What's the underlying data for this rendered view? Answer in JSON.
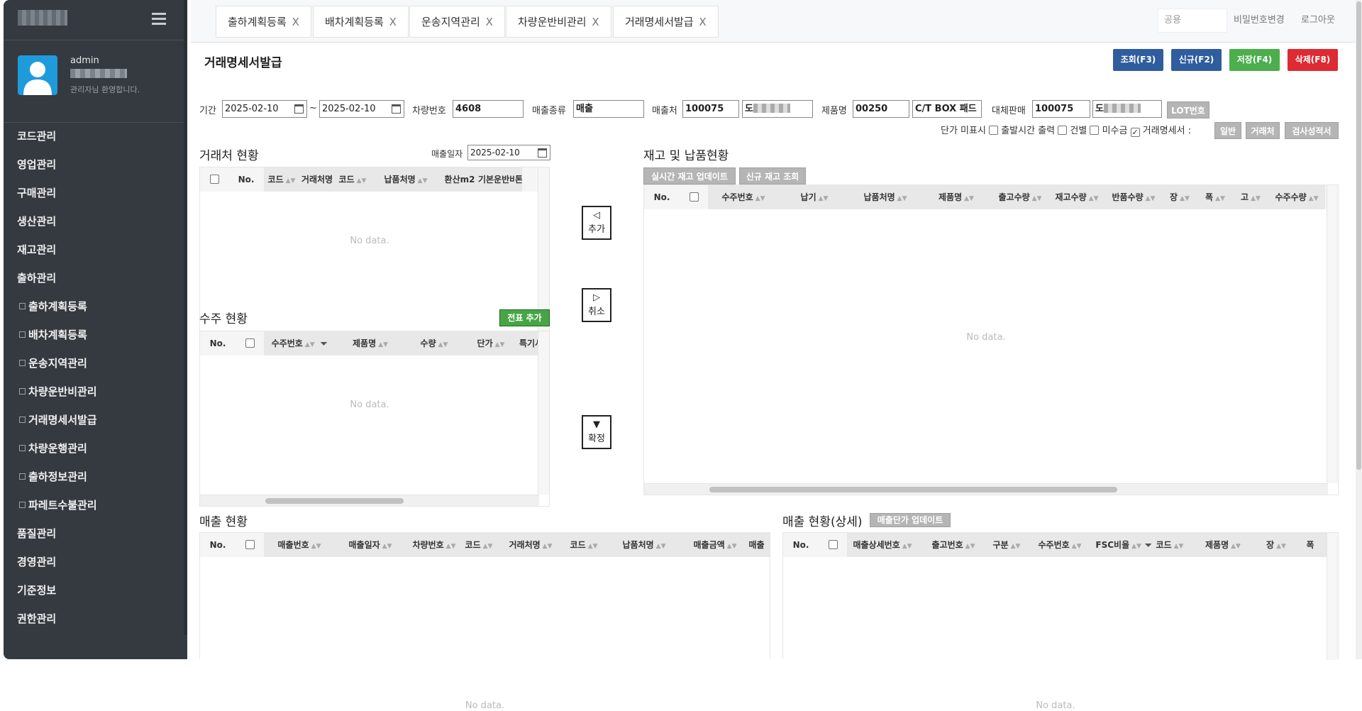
{
  "sidebar": {
    "user": {
      "name": "admin",
      "welcome": "관리자님 환영합니다."
    },
    "menu": [
      {
        "label": "코드관리",
        "sub": false
      },
      {
        "label": "영업관리",
        "sub": false
      },
      {
        "label": "구매관리",
        "sub": false
      },
      {
        "label": "생산관리",
        "sub": false
      },
      {
        "label": "재고관리",
        "sub": false
      },
      {
        "label": "출하관리",
        "sub": false
      },
      {
        "label": "출하계획등록",
        "sub": true
      },
      {
        "label": "배차계획등록",
        "sub": true
      },
      {
        "label": "운송지역관리",
        "sub": true
      },
      {
        "label": "차량운반비관리",
        "sub": true
      },
      {
        "label": "거래명세서발급",
        "sub": true
      },
      {
        "label": "차량운행관리",
        "sub": true
      },
      {
        "label": "출하정보관리",
        "sub": true
      },
      {
        "label": "파레트수불관리",
        "sub": true
      },
      {
        "label": "품질관리",
        "sub": false
      },
      {
        "label": "경영관리",
        "sub": false
      },
      {
        "label": "기준정보",
        "sub": false
      },
      {
        "label": "권한관리",
        "sub": false
      }
    ]
  },
  "tabs": [
    {
      "label": "출하계획등록",
      "close": "X"
    },
    {
      "label": "배차계획등록",
      "close": "X"
    },
    {
      "label": "운송지역관리",
      "close": "X"
    },
    {
      "label": "차량운반비관리",
      "close": "X"
    },
    {
      "label": "거래명세서발급",
      "close": "X"
    }
  ],
  "topbar": {
    "common": "공용",
    "change_password": "비밀번호변경",
    "logout": "로그아웃"
  },
  "page": {
    "title": "거래명세서발급",
    "buttons": {
      "search": "조회(F3)",
      "new": "신규(F2)",
      "save": "저장(F4)",
      "delete": "삭제(F8)"
    },
    "colors": {
      "search": "#2f5d9e",
      "new": "#2f5d9e",
      "save": "#4cae4c",
      "delete": "#dd2a33"
    },
    "filters": {
      "period_label": "기간",
      "date_from": "2025-02-10",
      "tilde": "~",
      "date_to": "2025-02-10",
      "vehicle_label": "차량번호",
      "vehicle_value": "4608",
      "sales_type_label": "매출종류",
      "sales_type_value": "매출",
      "customer_label": "매출처",
      "customer_code": "100075",
      "customer_name_prefix": "도",
      "product_label": "제품명",
      "product_code": "00250",
      "product_name": "C/T BOX 패드",
      "alt_sales_label": "대체판매",
      "alt_sales_code": "100075",
      "alt_sales_prefix": "도",
      "lot_button": "LOT번호"
    },
    "options": {
      "unit_price_hidden": "단가 미표시",
      "departure_time": "출발시간 출력",
      "per_item": "건별",
      "unpaid": "미수금",
      "statement": "거래명세서 :",
      "btn_general": "일반",
      "btn_customer": "거래처",
      "btn_inspection": "검사성적서"
    },
    "customer_status": {
      "title": "거래처 현황",
      "sales_date_label": "매출일자",
      "sales_date": "2025-02-10",
      "columns": [
        "No.",
        "코드",
        "거래처명",
        "코드",
        "납품처명",
        "환산m2",
        "기본운반비",
        "톤"
      ],
      "empty": "No data."
    },
    "order_status": {
      "title": "수주 현황",
      "add_button": "전표 추가",
      "columns": [
        "No.",
        "수주번호",
        "제품명",
        "수량",
        "단가",
        "특기사항"
      ],
      "empty": "No data."
    },
    "move_buttons": {
      "add_arrow": "◁",
      "add": "추가",
      "cancel_arrow": "▷",
      "cancel": "취소",
      "confirm_arrow": "▼",
      "confirm": "확정"
    },
    "stock_status": {
      "title": "재고 및 납품현황",
      "btn_realtime": "실시간 재고 업데이트",
      "btn_new_stock": "신규 재고 조회",
      "columns": [
        "No.",
        "수주번호",
        "납기",
        "납품처명",
        "제품명",
        "출고수량",
        "재고수량",
        "반품수량",
        "장",
        "폭",
        "고",
        "수주수량"
      ],
      "empty": "No data."
    },
    "sales_status": {
      "title": "매출 현황",
      "columns": [
        "No.",
        "매출번호",
        "매출일자",
        "차량번호",
        "코드",
        "거래처명",
        "코드",
        "납품처명",
        "매출금액",
        "매출"
      ],
      "empty": "No data."
    },
    "sales_detail": {
      "title": "매출 현황(상세)",
      "update_button": "매출단가 업데이트",
      "columns": [
        "No.",
        "매출상세번호",
        "출고번호",
        "구분",
        "수주번호",
        "FSC비율",
        "코드",
        "제품명",
        "장",
        "폭"
      ],
      "empty": "No data."
    }
  }
}
